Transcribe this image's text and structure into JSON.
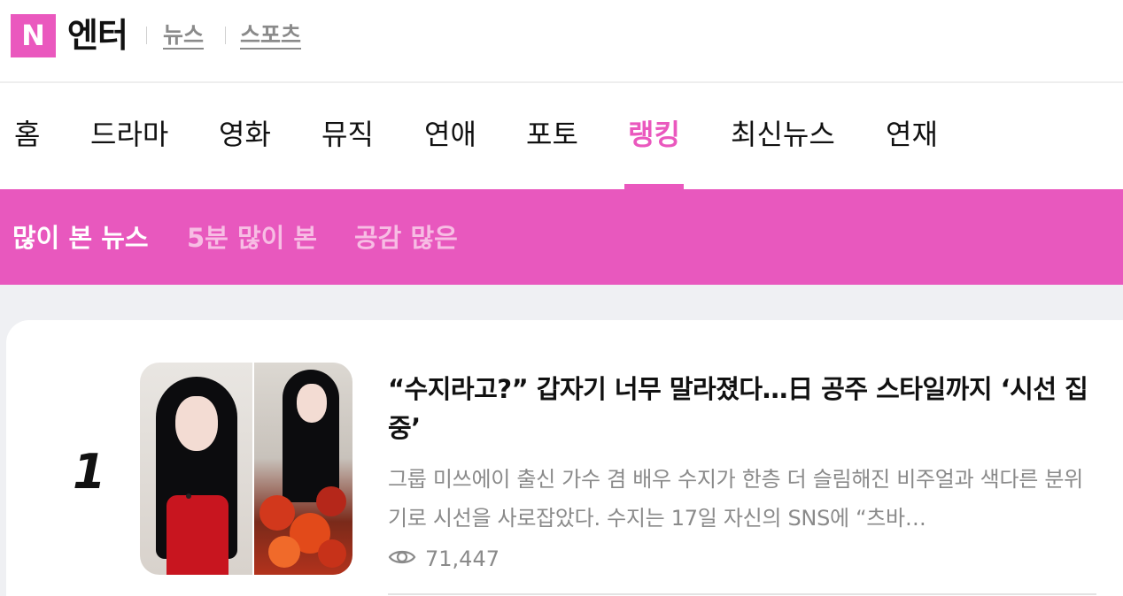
{
  "header": {
    "logo_letter": "N",
    "site_title": "엔터",
    "links": [
      "뉴스",
      "스포츠"
    ],
    "brand_color": "#ea58be"
  },
  "nav": {
    "items": [
      "홈",
      "드라마",
      "영화",
      "뮤직",
      "연애",
      "포토",
      "랭킹",
      "최신뉴스",
      "연재"
    ],
    "active": "랭킹"
  },
  "subtabs": {
    "items": [
      "많이 본 뉴스",
      "5분 많이 본",
      "공감 많은"
    ],
    "active": "많이 본 뉴스"
  },
  "articles": [
    {
      "rank": "1",
      "headline": "“수지라고?” 갑자기 너무 말라졌다…日 공주 스타일까지 ‘시선 집중’",
      "summary": "그룹 미쓰에이 출신 가수 겸 배우 수지가 한층 더 슬림해진 비주얼과 색다른 분위기로 시선을 사로잡았다. 수지는 17일 자신의 SNS에 “츠바…",
      "views": "71,447",
      "view_icon": "eye-icon"
    }
  ]
}
